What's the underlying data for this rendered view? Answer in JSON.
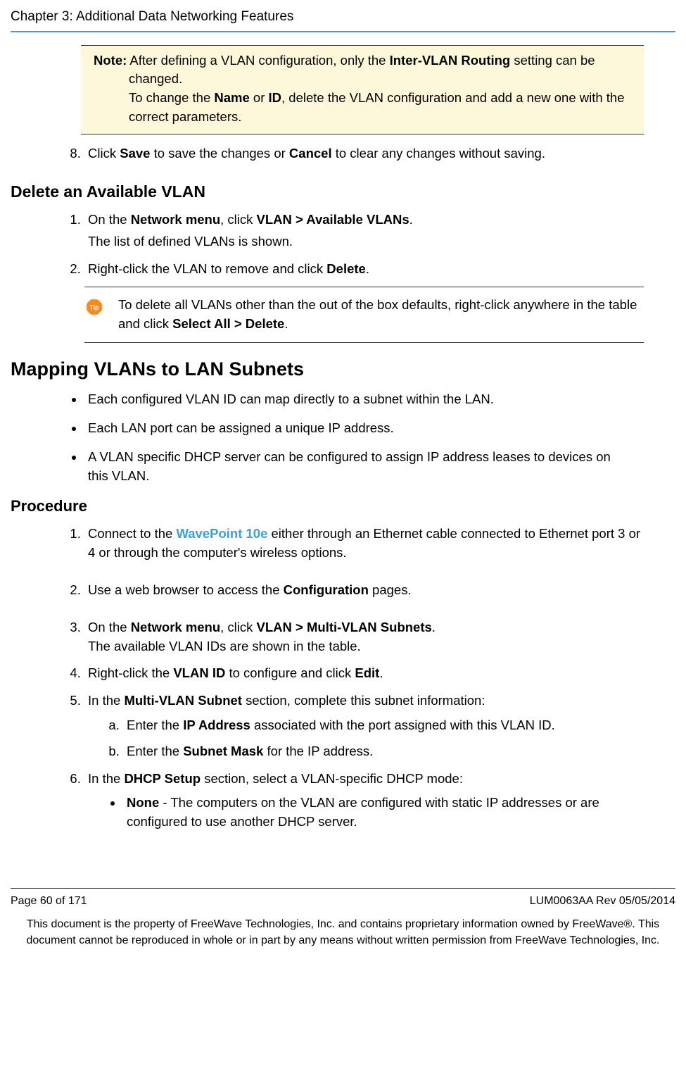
{
  "header": {
    "chapter_title": "Chapter 3: Additional Data Networking Features"
  },
  "note": {
    "label": "Note:",
    "line1_a": " After defining a VLAN configuration, only the ",
    "line1_b": "Inter-VLAN Routing",
    "line1_c": " setting can be changed.",
    "line2_a": "To change the ",
    "line2_b": "Name",
    "line2_c": " or ",
    "line2_d": "ID",
    "line2_e": ", delete the VLAN configuration and add a new one with the correct parameters."
  },
  "step8": {
    "a": "Click ",
    "b": "Save",
    "c": " to save the changes or ",
    "d": "Cancel",
    "e": " to clear any changes without saving."
  },
  "delete_section": {
    "heading": "Delete an Available VLAN",
    "s1a": "On the ",
    "s1b": "Network menu",
    "s1c": ", click ",
    "s1d": "VLAN > Available VLANs",
    "s1e": ".",
    "s1sub": "The list of defined VLANs is shown.",
    "s2a": "Right-click the VLAN to remove and click ",
    "s2b": "Delete",
    "s2c": "."
  },
  "tip": {
    "a": "To delete all VLANs other than the out of the box defaults, right-click anywhere in the table and click ",
    "b": "Select All > Delete",
    "c": "."
  },
  "mapping": {
    "heading": "Mapping VLANs to LAN Subnets",
    "b1": "Each configured VLAN ID can map directly to a subnet within the LAN.",
    "b2": "Each LAN port can be assigned a unique IP address.",
    "b3": "A VLAN specific DHCP server can be configured to assign IP address leases to devices on this VLAN."
  },
  "procedure": {
    "heading": "Procedure",
    "s1a": "Connect to the ",
    "s1link": "WavePoint 10e",
    "s1b": " either through an Ethernet cable connected to Ethernet port 3 or 4 or through the computer's wireless options.",
    "s2a": "Use a web browser to access the ",
    "s2b": "Configuration",
    "s2c": " pages.",
    "s3a": "On the ",
    "s3b": "Network menu",
    "s3c": ", click ",
    "s3d": "VLAN > Multi-VLAN Subnets",
    "s3e": ".",
    "s3sub": "The available VLAN IDs are shown in the table.",
    "s4a": "Right-click the ",
    "s4b": "VLAN ID",
    "s4c": " to configure and click ",
    "s4d": "Edit",
    "s4e": ".",
    "s5a": "In the ",
    "s5b": "Multi-VLAN Subnet",
    "s5c": " section, complete this subnet information:",
    "s5aa": "Enter the ",
    "s5ab": "IP Address",
    "s5ac": " associated with the port assigned with this VLAN ID.",
    "s5ba": "Enter the ",
    "s5bb": "Subnet Mask",
    "s5bc": " for the IP address.",
    "s6a": "In the ",
    "s6b": "DHCP Setup",
    "s6c": " section, select a VLAN-specific DHCP mode:",
    "s6la": "None",
    "s6lb": " - The computers on the VLAN are configured with static IP addresses or are configured to use another DHCP server."
  },
  "footer": {
    "page": "Page 60 of 171",
    "docid": "LUM0063AA Rev 05/05/2014",
    "legal": "This document is the property of FreeWave Technologies, Inc. and contains proprietary information owned by FreeWave®. This document cannot be reproduced in whole or in part by any means without written permission from FreeWave Technologies, Inc."
  }
}
